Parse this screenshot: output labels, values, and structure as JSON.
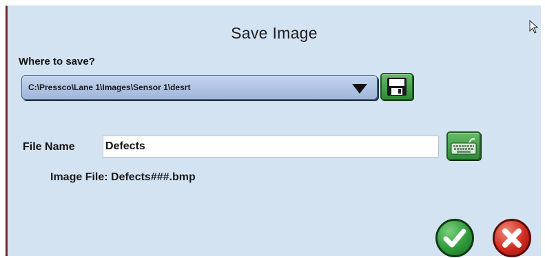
{
  "dialog": {
    "title": "Save Image"
  },
  "save_location": {
    "label": "Where to save?",
    "selected_path": "C:\\Pressco\\Lane 1\\Images\\Sensor 1\\desrt"
  },
  "file_name": {
    "label": "File Name",
    "value": "Defects"
  },
  "image_file": {
    "text": "Image File: Defects###.bmp"
  },
  "icons": {
    "save": "floppy-disk-icon",
    "keyboard": "keyboard-icon",
    "ok": "checkmark-icon",
    "cancel": "close-x-icon",
    "dropdown": "dropdown-arrow-icon",
    "cursor": "mouse-pointer-icon"
  },
  "colors": {
    "dialog_background": "#d4e3f2",
    "ok_green": "#2f9a3a",
    "cancel_red": "#d22a1e",
    "select_blue": "#a9bfe0"
  }
}
